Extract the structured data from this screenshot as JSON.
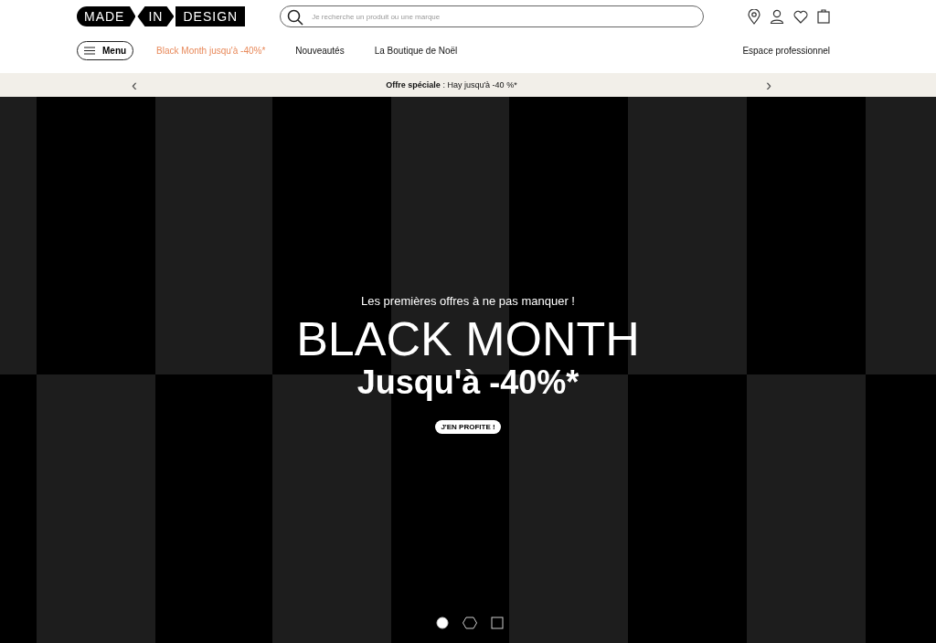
{
  "logo": {
    "parts": [
      "MADE",
      "IN",
      "DESIGN"
    ]
  },
  "search": {
    "placeholder": "Je recherche un produit ou une marque"
  },
  "menu_button": {
    "label": "Menu"
  },
  "nav": [
    {
      "label": "Black Month jusqu'à -40%*",
      "highlighted": true
    },
    {
      "label": "Nouveautés",
      "highlighted": false
    },
    {
      "label": "La Boutique de Noël",
      "highlighted": false
    }
  ],
  "pro_link": "Espace professionnel",
  "promo_bar": {
    "prev": "‹",
    "text": "**Offre spéciale** : Hay jusqu'à -40 %*",
    "next": "›"
  },
  "hero": {
    "kicker": "Les premières offres à ne pas manquer !",
    "title": "BLACK MONTH",
    "subtitle": "Jusqu'à -40%*",
    "button": "J'EN PROFITE !"
  },
  "slides": [
    {
      "kind": "circle",
      "selected": true
    },
    {
      "kind": "hexagon",
      "selected": false
    },
    {
      "kind": "square",
      "selected": false
    }
  ]
}
